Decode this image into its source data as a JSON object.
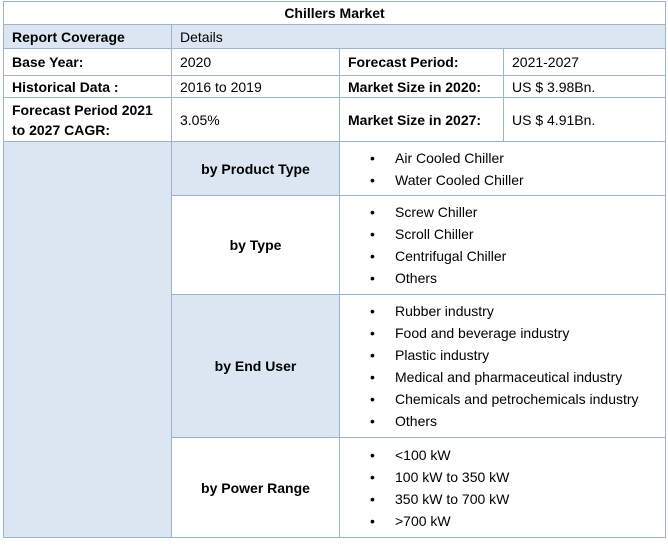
{
  "title": "Chillers Market",
  "coverage": {
    "label": "Report Coverage",
    "value": "Details"
  },
  "rows": {
    "base_year": {
      "label": "Base Year:",
      "value": "2020"
    },
    "forecast_period": {
      "label": "Forecast Period:",
      "value": "2021-2027"
    },
    "historical": {
      "label": "Historical Data :",
      "value": "2016 to 2019"
    },
    "size_2020": {
      "label": "Market Size in 2020:",
      "value": "US $ 3.98Bn."
    },
    "cagr": {
      "label": "Forecast Period 2021 to 2027 CAGR:",
      "value": "3.05%"
    },
    "size_2027": {
      "label": "Market Size in 2027:",
      "value": "US $ 4.91Bn."
    }
  },
  "segments": [
    {
      "label": "by Product Type",
      "items": [
        "Air Cooled Chiller",
        "Water Cooled Chiller"
      ]
    },
    {
      "label": "by Type",
      "items": [
        "Screw Chiller",
        "Scroll Chiller",
        "Centrifugal Chiller",
        "Others"
      ]
    },
    {
      "label": "by End User",
      "items": [
        "Rubber industry",
        "Food and beverage industry",
        "Plastic industry",
        "Medical and pharmaceutical industry",
        "Chemicals and petrochemicals industry",
        "Others"
      ]
    },
    {
      "label": "by Power Range",
      "items": [
        "<100 kW",
        "100 kW to 350 kW",
        "350 kW to 700 kW",
        ">700 kW"
      ]
    }
  ]
}
